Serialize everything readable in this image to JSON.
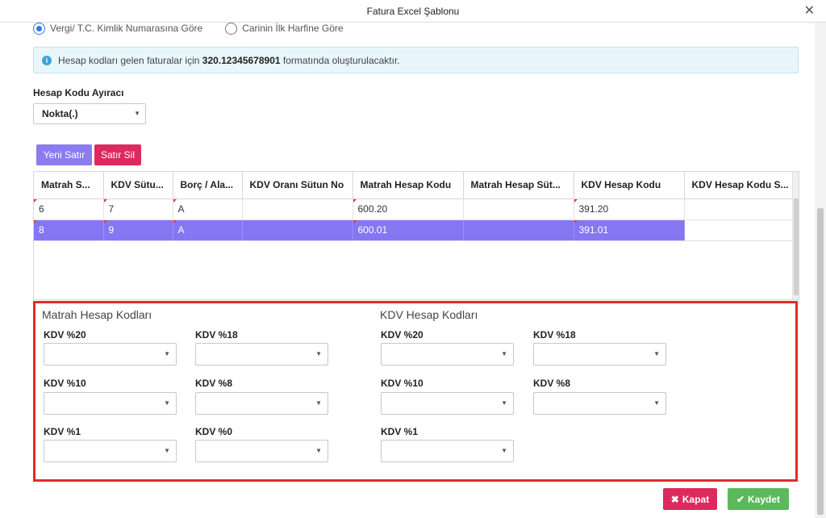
{
  "window": {
    "title": "Fatura Excel Şablonu"
  },
  "radios": [
    {
      "label": "Vergi/ T.C. Kimlik Numarasına Göre",
      "checked": true
    },
    {
      "label": "Carinin İlk Harfine Göre",
      "checked": false
    }
  ],
  "info": {
    "prefix": "Hesap kodları gelen faturalar için",
    "code": "320.12345678901",
    "suffix": "formatında oluşturulacaktır."
  },
  "separator": {
    "label": "Hesap Kodu Ayıracı",
    "value": "Nokta(.)"
  },
  "buttons": {
    "new_row": "Yeni Satır",
    "delete_row": "Satır Sil",
    "close": "Kapat",
    "save": "Kaydet"
  },
  "grid": {
    "columns": [
      "Matrah Sütun No",
      "KDV Sütun No",
      "Borç / Alacak",
      "KDV Oranı Sütun No",
      "Matrah Hesap Kodu",
      "Matrah Hesap Sütun No",
      "KDV Hesap Kodu",
      "KDV Hesap Kodu Sütun No"
    ],
    "columns_display": [
      "Matrah S...",
      "KDV Sütu...",
      "Borç / Ala...",
      "KDV Oranı Sütun No",
      "Matrah Hesap Kodu",
      "Matrah Hesap Süt...",
      "KDV Hesap Kodu",
      "KDV Hesap Kodu S..."
    ],
    "rows": [
      [
        "6",
        "7",
        "A",
        "",
        "600.20",
        "",
        "391.20",
        ""
      ],
      [
        "8",
        "9",
        "A",
        "",
        "600.01",
        "",
        "391.01",
        ""
      ]
    ]
  },
  "matrah": {
    "title": "Matrah Hesap Kodları",
    "fields": [
      "KDV %20",
      "KDV %18",
      "KDV %10",
      "KDV %8",
      "KDV %1",
      "KDV %0"
    ]
  },
  "kdv": {
    "title": "KDV Hesap Kodları",
    "fields": [
      "KDV %20",
      "KDV %18",
      "KDV %10",
      "KDV %8",
      "KDV %1"
    ]
  },
  "colors": {
    "accent": "#8577f2",
    "danger": "#dc2a5c",
    "success": "#5cb85c",
    "highlight": "#e02c2c"
  }
}
